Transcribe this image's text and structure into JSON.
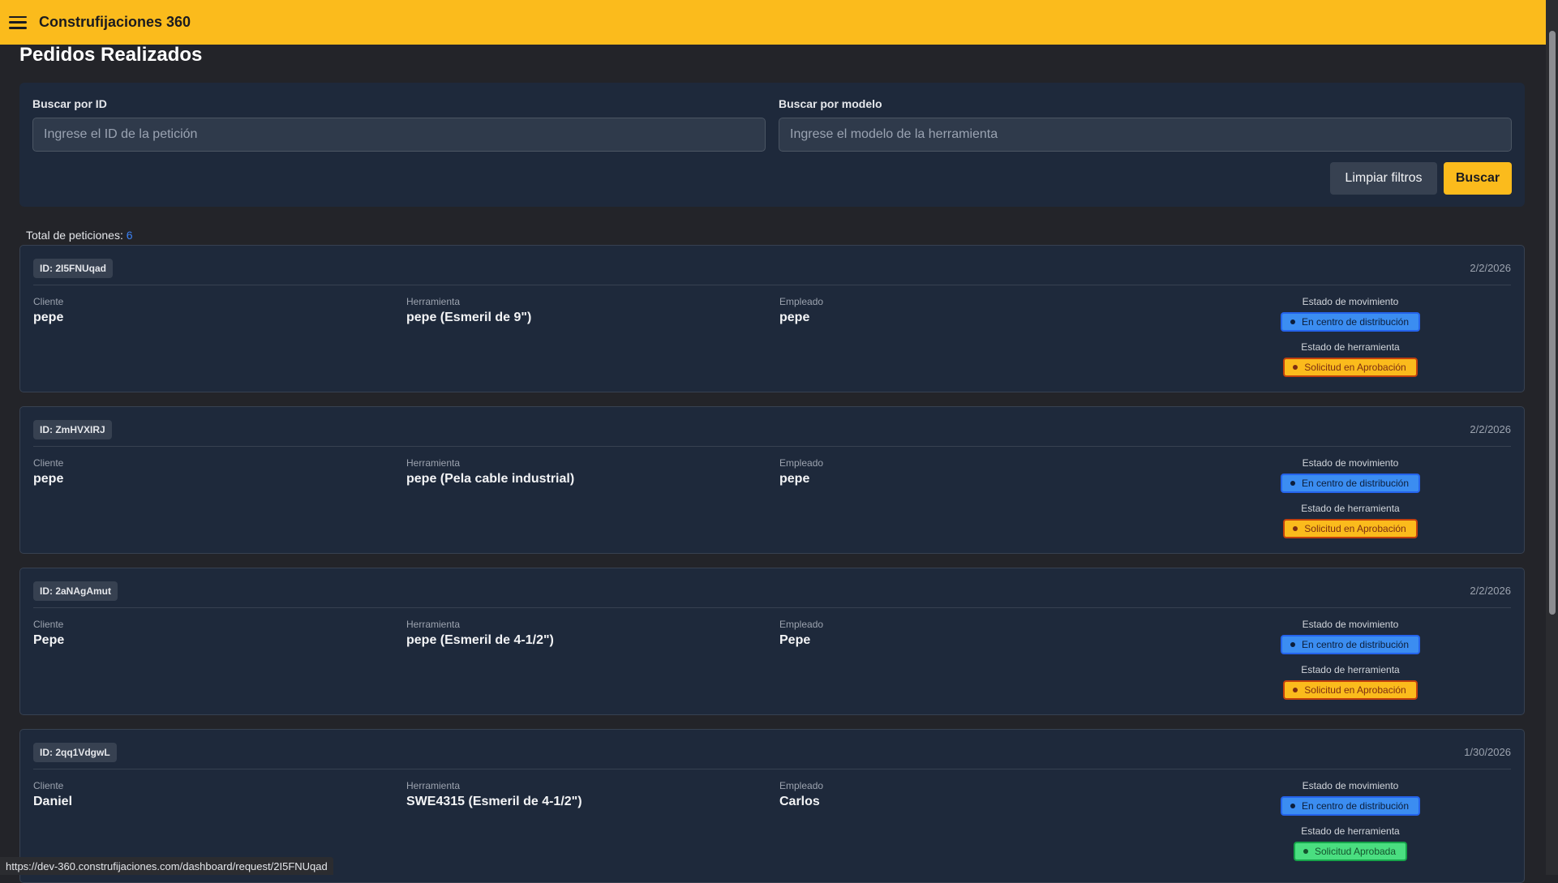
{
  "app": {
    "brand": "Construfijaciones 360"
  },
  "page": {
    "title": "Pedidos Realizados"
  },
  "filters": {
    "id_label": "Buscar por ID",
    "id_placeholder": "Ingrese el ID de la petición",
    "model_label": "Buscar por modelo",
    "model_placeholder": "Ingrese el modelo de la herramienta",
    "clear_label": "Limpiar filtros",
    "search_label": "Buscar"
  },
  "summary": {
    "label": "Total de peticiones:",
    "count": "6"
  },
  "labels": {
    "client": "Cliente",
    "tool": "Herramienta",
    "employee": "Empleado",
    "movement_status": "Estado de movimiento",
    "tool_status": "Estado de herramienta"
  },
  "requests": [
    {
      "id": "ID: 2I5FNUqad",
      "date": "2/2/2026",
      "client": "pepe",
      "tool": "pepe (Esmeril de 9\")",
      "employee": "pepe",
      "movement_status": "En centro de distribución",
      "tool_status": "Solicitud en Aprobación",
      "tool_status_color": "#fbbb1c"
    },
    {
      "id": "ID: ZmHVXIRJ",
      "date": "2/2/2026",
      "client": "pepe",
      "tool": "pepe (Pela cable industrial)",
      "employee": "pepe",
      "movement_status": "En centro de distribución",
      "tool_status": "Solicitud en Aprobación",
      "tool_status_color": "#fbbb1c"
    },
    {
      "id": "ID: 2aNAgAmut",
      "date": "2/2/2026",
      "client": "Pepe",
      "tool": "pepe (Esmeril de 4-1/2\")",
      "employee": "Pepe",
      "movement_status": "En centro de distribución",
      "tool_status": "Solicitud en Aprobación",
      "tool_status_color": "#fbbb1c"
    },
    {
      "id": "ID: 2qq1VdgwL",
      "date": "1/30/2026",
      "client": "Daniel",
      "tool": "SWE4315 (Esmeril de 4-1/2\")",
      "employee": "Carlos",
      "movement_status": "En centro de distribución",
      "tool_status": "Solicitud Aprobada",
      "tool_status_color": "#4ade80"
    }
  ],
  "browser": {
    "status_url": "https://dev-360.construfijaciones.com/dashboard/request/2I5FNUqad"
  },
  "icons": {
    "menu": "hamburger-menu-icon"
  },
  "colors": {
    "accent": "#fbbb1c",
    "background": "#232429",
    "card": "#1e293b",
    "info": "#3b8df1",
    "success": "#4ade80"
  }
}
